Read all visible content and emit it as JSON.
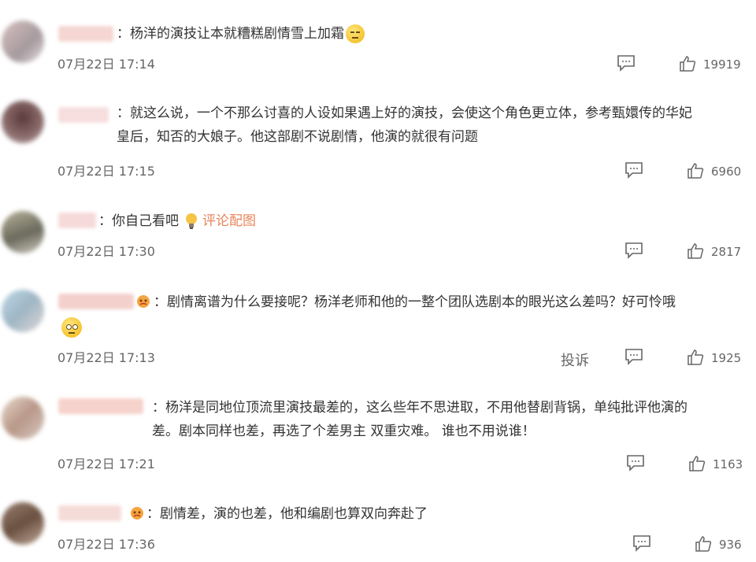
{
  "comments": [
    {
      "text": "杨洋的演技让本就糟糕剧情雪上加霜",
      "time": "07月22日 17:14",
      "likes": "19919"
    },
    {
      "text": "就这么说，一个不那么讨喜的人设如果遇上好的演技，会使这个角色更立体，参考甄嬛传的华妃\n皇后，知否的大娘子。他这部剧不说剧情，他演的就很有问题",
      "time": "07月22日 17:15",
      "likes": "6960"
    },
    {
      "text": "你自己看吧",
      "pic_label": "评论配图",
      "time": "07月22日 17:30",
      "likes": "2817"
    },
    {
      "text": "剧情离谱为什么要接呢？杨洋老师和他的一整个团队选剧本的眼光这么差吗？好可怜哦",
      "time": "07月22日 17:13",
      "likes": "1925",
      "report": "投诉"
    },
    {
      "text": "杨洋是同地位顶流里演技最差的，这么些年不思进取，不用他替剧背锅，单纯批评他演的\n差。剧本同样也差，再选了个差男主 双重灾难。 谁也不用说谁！",
      "time": "07月22日 17:21",
      "likes": "1163"
    },
    {
      "text": "剧情差，演的也差，他和编剧也算双向奔赴了",
      "time": "07月22日 17:36",
      "likes": "936"
    }
  ],
  "colon": "："
}
